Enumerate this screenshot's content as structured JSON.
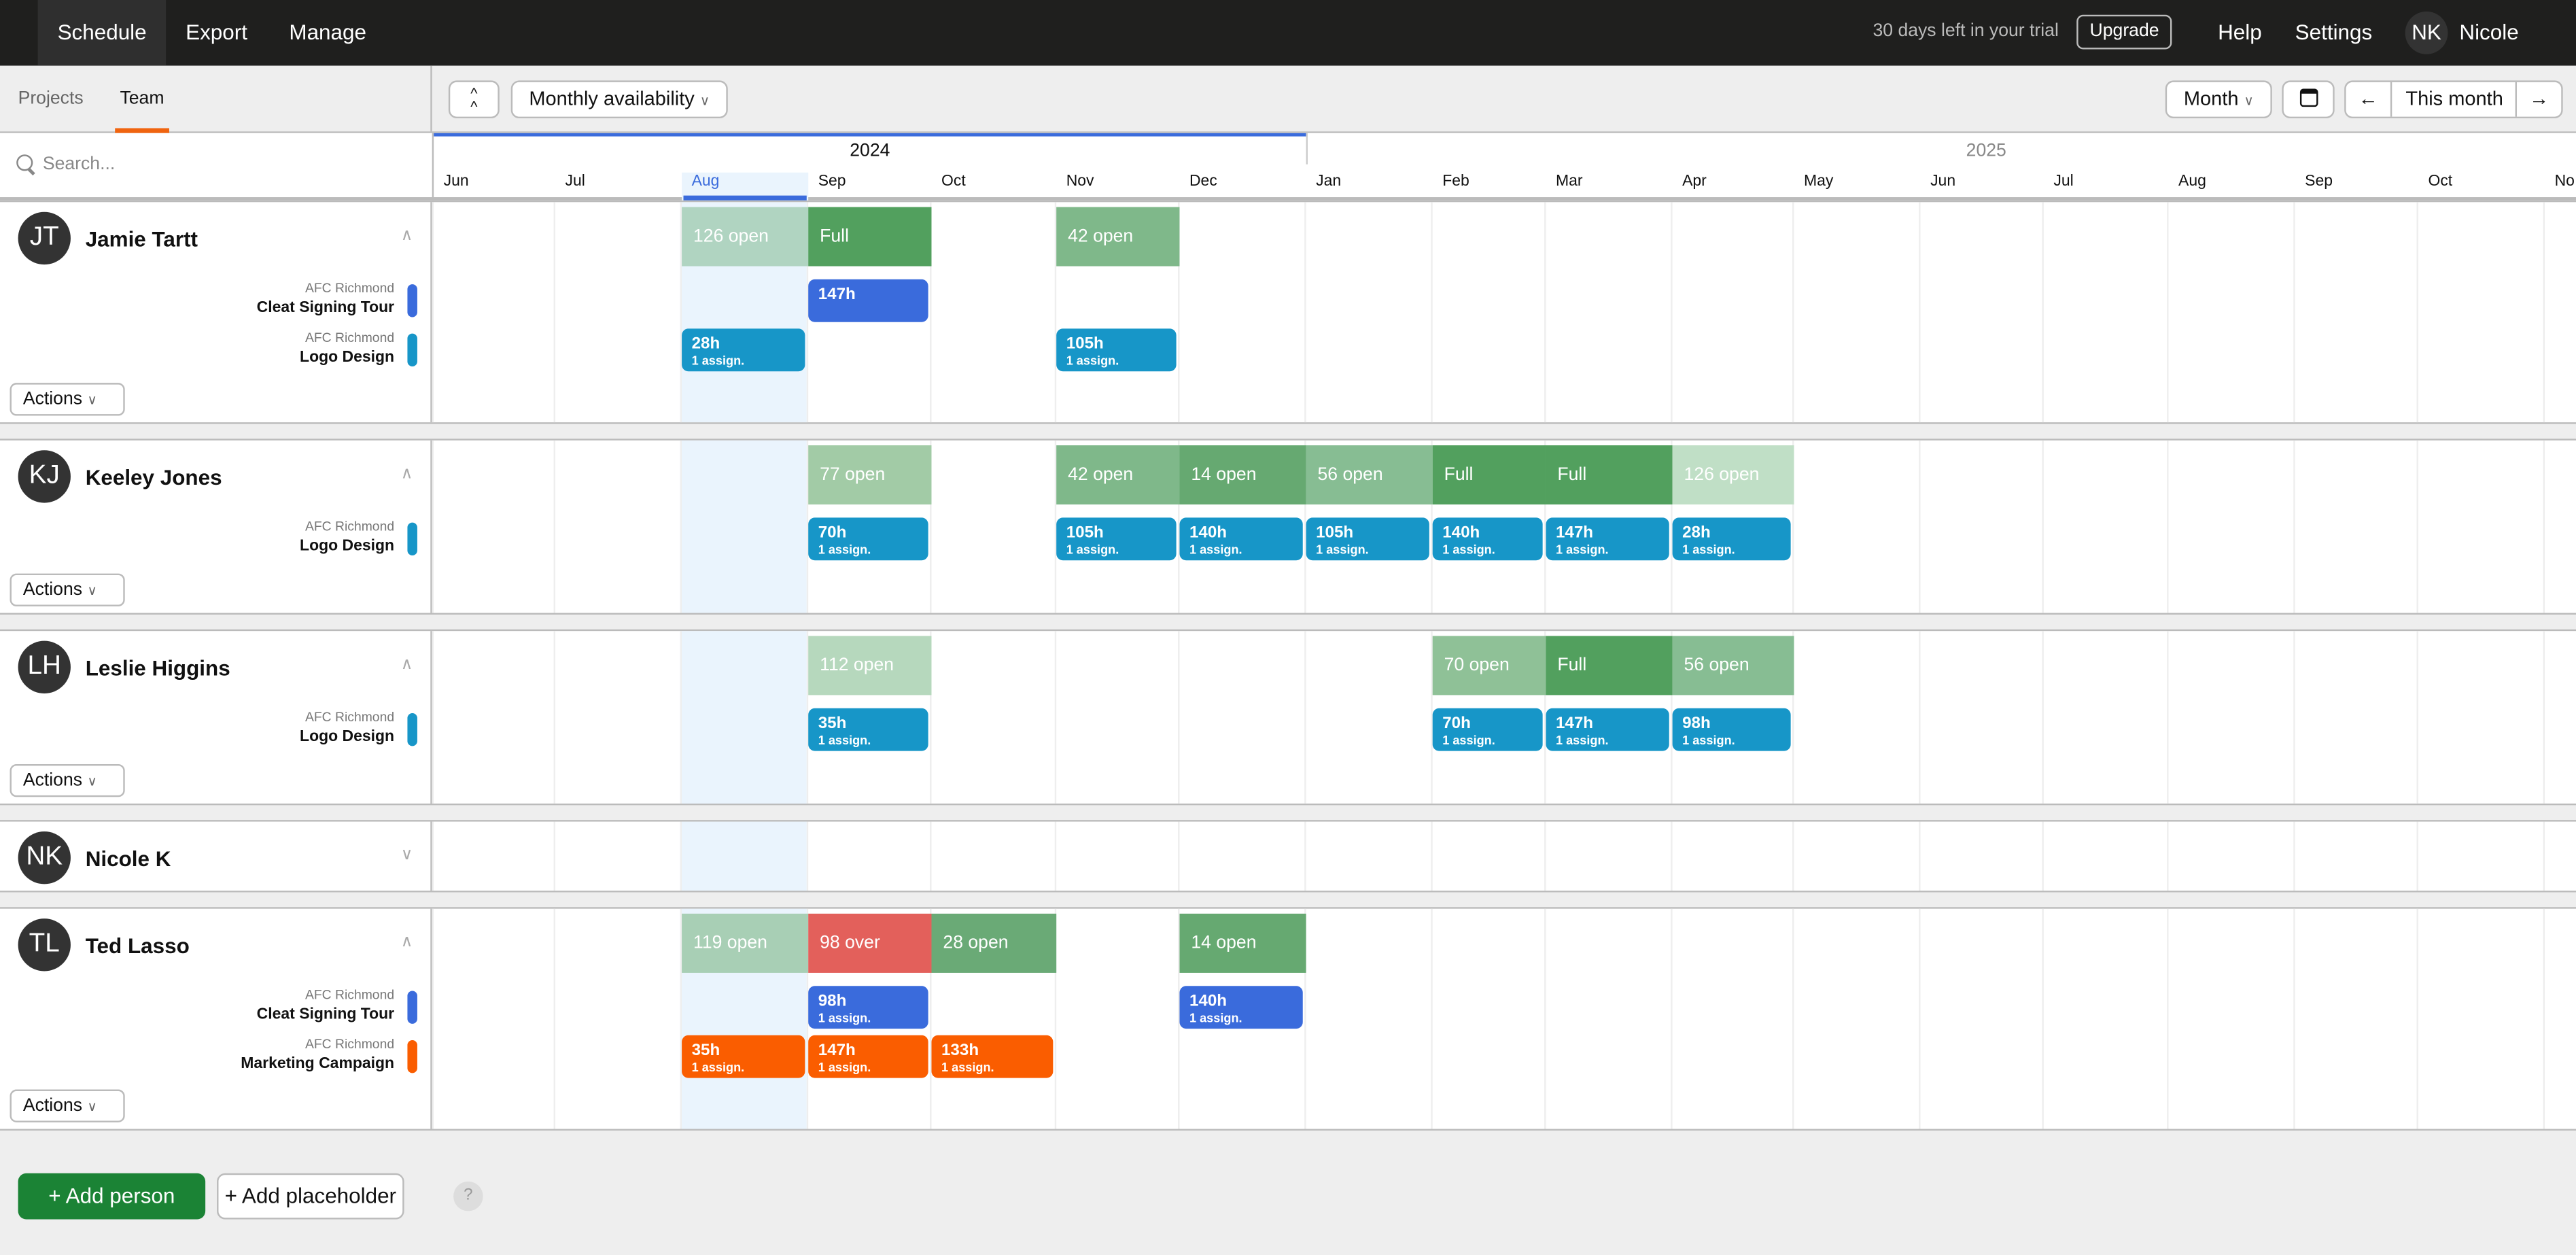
{
  "topbar": {
    "tabs": [
      "Schedule",
      "Export",
      "Manage"
    ],
    "active_tab": "Schedule",
    "trial_text": "30 days left in your trial",
    "upgrade": "Upgrade",
    "help": "Help",
    "settings": "Settings",
    "user_initials": "NK",
    "user_name": "Nicole"
  },
  "toolbar": {
    "left_tabs": [
      "Projects",
      "Team"
    ],
    "active_left_tab": "Team",
    "collapse_icon": "double-chevron-up-icon",
    "view_select": "Monthly availability",
    "scale_select": "Month",
    "calendar_icon": "calendar-icon",
    "prev_icon": "arrow-left-icon",
    "today": "This month",
    "next_icon": "arrow-right-icon"
  },
  "search": {
    "placeholder": "Search..."
  },
  "timeline": {
    "years": [
      "2024",
      "2025"
    ],
    "months": [
      "Jun",
      "Jul",
      "Aug",
      "Sep",
      "Oct",
      "Nov",
      "Dec",
      "Jan",
      "Feb",
      "Mar",
      "Apr",
      "May",
      "Jun",
      "Jul",
      "Aug",
      "Sep",
      "Oct",
      "No"
    ],
    "current_month_index": 2
  },
  "colors": {
    "cleat_signing_tour": "#3a6bdc",
    "logo_design": "#1796c8",
    "marketing_campaign": "#fa5d00",
    "full": "#52a05e",
    "over": "#e3605b",
    "current_month": "#eaf4fd",
    "add_person": "#1b8335"
  },
  "people": [
    {
      "initials": "JT",
      "name": "Jamie Tartt",
      "expanded": true,
      "actions": "Actions",
      "availability": [
        {
          "m": 2,
          "label": "126 open",
          "color": "#b0d4c1"
        },
        {
          "m": 3,
          "label": "Full",
          "color": "#52a05e"
        },
        {
          "m": 5,
          "label": "42 open",
          "color": "#7fb88a"
        }
      ],
      "projects": [
        {
          "client": "AFC Richmond",
          "name": "Cleat Signing Tour",
          "color": "#3a6bdc",
          "assignments": [
            {
              "m": 3,
              "hours": "147h",
              "sub": ""
            }
          ]
        },
        {
          "client": "AFC Richmond",
          "name": "Logo Design",
          "color": "#1796c8",
          "assignments": [
            {
              "m": 2,
              "hours": "28h",
              "sub": "1 assign."
            },
            {
              "m": 5,
              "hours": "105h",
              "sub": "1 assign."
            }
          ]
        }
      ]
    },
    {
      "initials": "KJ",
      "name": "Keeley Jones",
      "expanded": true,
      "actions": "Actions",
      "availability": [
        {
          "m": 3,
          "label": "77 open",
          "color": "#a2cba6"
        },
        {
          "m": 5,
          "label": "42 open",
          "color": "#7fb88a"
        },
        {
          "m": 6,
          "label": "14 open",
          "color": "#66a971"
        },
        {
          "m": 7,
          "label": "56 open",
          "color": "#87bd93"
        },
        {
          "m": 8,
          "label": "Full",
          "color": "#52a05e"
        },
        {
          "m": 9,
          "label": "Full",
          "color": "#52a05e"
        },
        {
          "m": 10,
          "label": "126 open",
          "color": "#c0dfc6"
        }
      ],
      "projects": [
        {
          "client": "AFC Richmond",
          "name": "Logo Design",
          "color": "#1796c8",
          "assignments": [
            {
              "m": 3,
              "hours": "70h",
              "sub": "1 assign."
            },
            {
              "m": 5,
              "hours": "105h",
              "sub": "1 assign."
            },
            {
              "m": 6,
              "hours": "140h",
              "sub": "1 assign."
            },
            {
              "m": 7,
              "hours": "105h",
              "sub": "1 assign."
            },
            {
              "m": 8,
              "hours": "140h",
              "sub": "1 assign."
            },
            {
              "m": 9,
              "hours": "147h",
              "sub": "1 assign."
            },
            {
              "m": 10,
              "hours": "28h",
              "sub": "1 assign."
            }
          ]
        }
      ]
    },
    {
      "initials": "LH",
      "name": "Leslie Higgins",
      "expanded": true,
      "actions": "Actions",
      "availability": [
        {
          "m": 3,
          "label": "112 open",
          "color": "#b6d8bd"
        },
        {
          "m": 8,
          "label": "70 open",
          "color": "#8fc197"
        },
        {
          "m": 9,
          "label": "Full",
          "color": "#52a05e"
        },
        {
          "m": 10,
          "label": "56 open",
          "color": "#87bd93"
        }
      ],
      "projects": [
        {
          "client": "AFC Richmond",
          "name": "Logo Design",
          "color": "#1796c8",
          "assignments": [
            {
              "m": 3,
              "hours": "35h",
              "sub": "1 assign."
            },
            {
              "m": 8,
              "hours": "70h",
              "sub": "1 assign."
            },
            {
              "m": 9,
              "hours": "147h",
              "sub": "1 assign."
            },
            {
              "m": 10,
              "hours": "98h",
              "sub": "1 assign."
            }
          ]
        }
      ]
    },
    {
      "initials": "NK",
      "name": "Nicole K",
      "expanded": false,
      "actions": "",
      "availability": [],
      "projects": []
    },
    {
      "initials": "TL",
      "name": "Ted Lasso",
      "expanded": true,
      "actions": "Actions",
      "availability": [
        {
          "m": 2,
          "label": "119 open",
          "color": "#a8cfb5"
        },
        {
          "m": 3,
          "label": "98 over",
          "color": "#e3605b"
        },
        {
          "m": 4,
          "label": "28 open",
          "color": "#6aaa76"
        },
        {
          "m": 6,
          "label": "14 open",
          "color": "#66a971"
        }
      ],
      "projects": [
        {
          "client": "AFC Richmond",
          "name": "Cleat Signing Tour",
          "color": "#3a6bdc",
          "assignments": [
            {
              "m": 3,
              "hours": "98h",
              "sub": "1 assign."
            },
            {
              "m": 6,
              "hours": "140h",
              "sub": "1 assign."
            }
          ]
        },
        {
          "client": "AFC Richmond",
          "name": "Marketing Campaign",
          "color": "#fa5d00",
          "assignments": [
            {
              "m": 2,
              "hours": "35h",
              "sub": "1 assign."
            },
            {
              "m": 3,
              "hours": "147h",
              "sub": "1 assign."
            },
            {
              "m": 4,
              "hours": "133h",
              "sub": "1 assign."
            }
          ]
        }
      ]
    }
  ],
  "footer": {
    "add_person": "+ Add person",
    "add_placeholder": "+ Add placeholder",
    "help": "?"
  }
}
